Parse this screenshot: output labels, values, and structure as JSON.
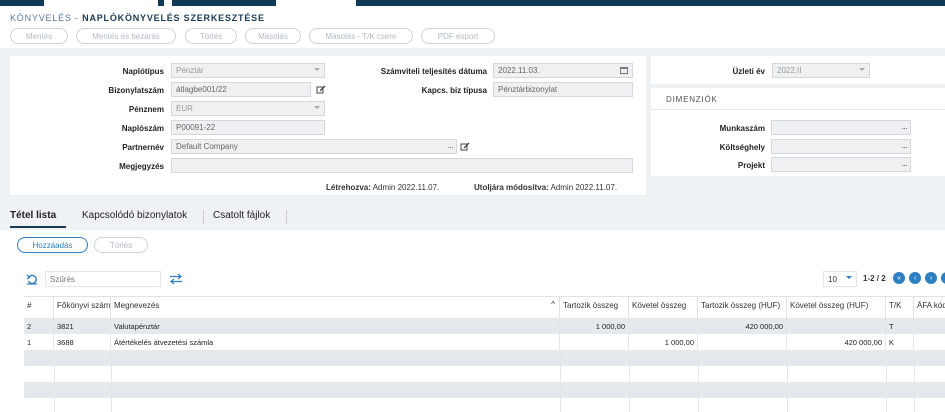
{
  "header": {
    "breadcrumb": "KÖNYVELÉS -",
    "title": "NAPLÓKÖNYVELÉS SZERKESZTÉSE"
  },
  "toolbar": {
    "save": "Mentés",
    "save_close": "Mentés és bezárás",
    "delete": "Törlés",
    "copy": "Másolás",
    "copy_tk": "Másolás - T/K csere",
    "pdf": "PDF export"
  },
  "form": {
    "journal_type_label": "Naplótípus",
    "journal_type_value": "Pénztár",
    "doc_number_label": "Bizonylatszám",
    "doc_number_value": "átlagbe001/22",
    "currency_label": "Pénznem",
    "currency_value": "EUR",
    "journal_number_label": "Naplószám",
    "journal_number_value": "P00091-22",
    "partner_label": "Partnernév",
    "partner_value": "Default Company",
    "note_label": "Megjegyzés",
    "note_value": "",
    "accounting_date_label": "Számviteli teljesítés dátuma",
    "accounting_date_value": "2022.11.03.",
    "related_doc_type_label": "Kapcs. biz típusa",
    "related_doc_type_value": "Pénztárbizonylat",
    "created_label": "Létrehozva:",
    "created_value": "Admin 2022.11.07.",
    "modified_label": "Utoljára módosítva:",
    "modified_value": "Admin 2022.11.07."
  },
  "side": {
    "fiscal_year_label": "Üzleti év",
    "fiscal_year_value": "2022.II",
    "dimensions_title": "DIMENZIÓK",
    "worknum_label": "Munkaszám",
    "costcenter_label": "Költséghely",
    "project_label": "Projekt",
    "dots": "..."
  },
  "tabs": {
    "items": [
      "Tétel lista",
      "Kapcsolódó bizonylatok",
      "Csatolt fájlok"
    ],
    "active": 0
  },
  "list": {
    "add": "Hozzáadás",
    "delete": "Törlés",
    "filter_placeholder": "Szűrés",
    "page_size": "10",
    "page_info": "1-2 / 2"
  },
  "table": {
    "columns": [
      "#",
      "Főkönyvi szám",
      "Megnevezés",
      "Tartozik összeg",
      "Követel összeg",
      "Tartozik összeg (HUF)",
      "Követel összeg (HUF)",
      "T/K",
      "ÁFA kód"
    ],
    "rows": [
      [
        "2",
        "3821",
        "Valutapénztár",
        "1 000,00",
        "",
        "420 000,00",
        "",
        "T",
        ""
      ],
      [
        "1",
        "3688",
        "Átértékelés átvezetési számla",
        "",
        "1 000,00",
        "",
        "420 000,00",
        "K",
        ""
      ]
    ]
  },
  "colors": {
    "topbar": "#0e3a57",
    "accent": "#2f7ec1",
    "panel": "#ffffff",
    "background": "#eef2f5"
  }
}
